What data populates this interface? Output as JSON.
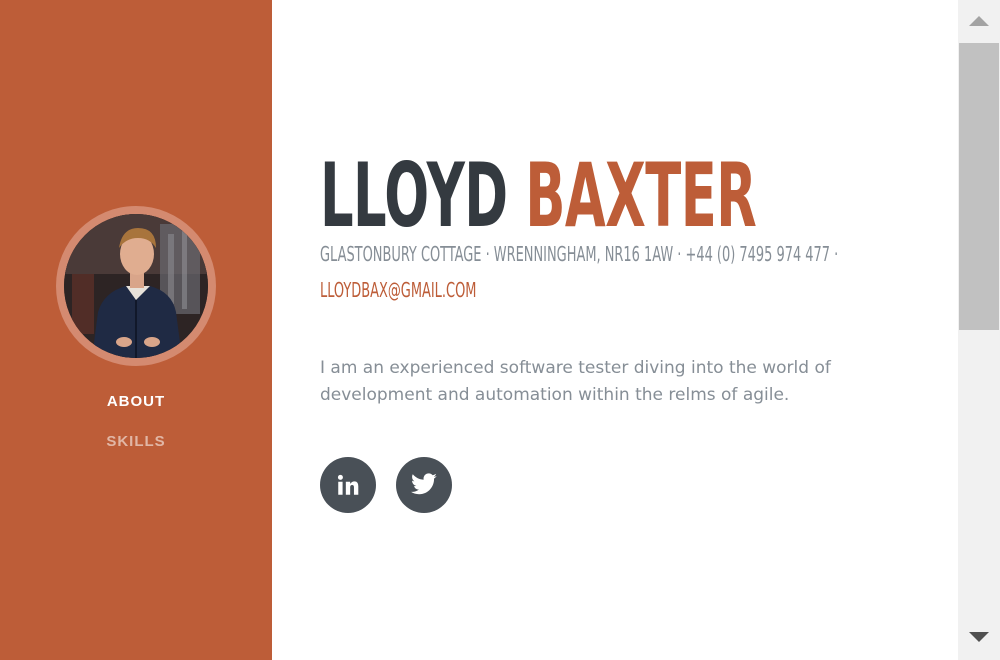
{
  "sidebar": {
    "avatar": {
      "alt": "Lloyd Baxter",
      "icon": "profile-photo"
    },
    "nav": [
      {
        "label": "ABOUT",
        "active": true
      },
      {
        "label": "SKILLS",
        "active": false
      }
    ]
  },
  "main": {
    "first_name": "LLOYD",
    "last_name": "BAXTER",
    "address": "GLASTONBURY COTTAGE · WRENNINGHAM, NR16 1AW · +44 (0) 7495 974 477 ·",
    "email": "LLOYDBAX@GMAIL.COM",
    "intro": "I am an experienced software tester diving into the world of development and automation within the relms of agile.",
    "social": [
      {
        "name": "LinkedIn",
        "icon": "linkedin-icon"
      },
      {
        "name": "Twitter",
        "icon": "twitter-icon"
      }
    ]
  },
  "colors": {
    "primary": "#bd5d38",
    "heading": "#343a40",
    "muted": "#868e96",
    "social_bg": "#495057"
  }
}
